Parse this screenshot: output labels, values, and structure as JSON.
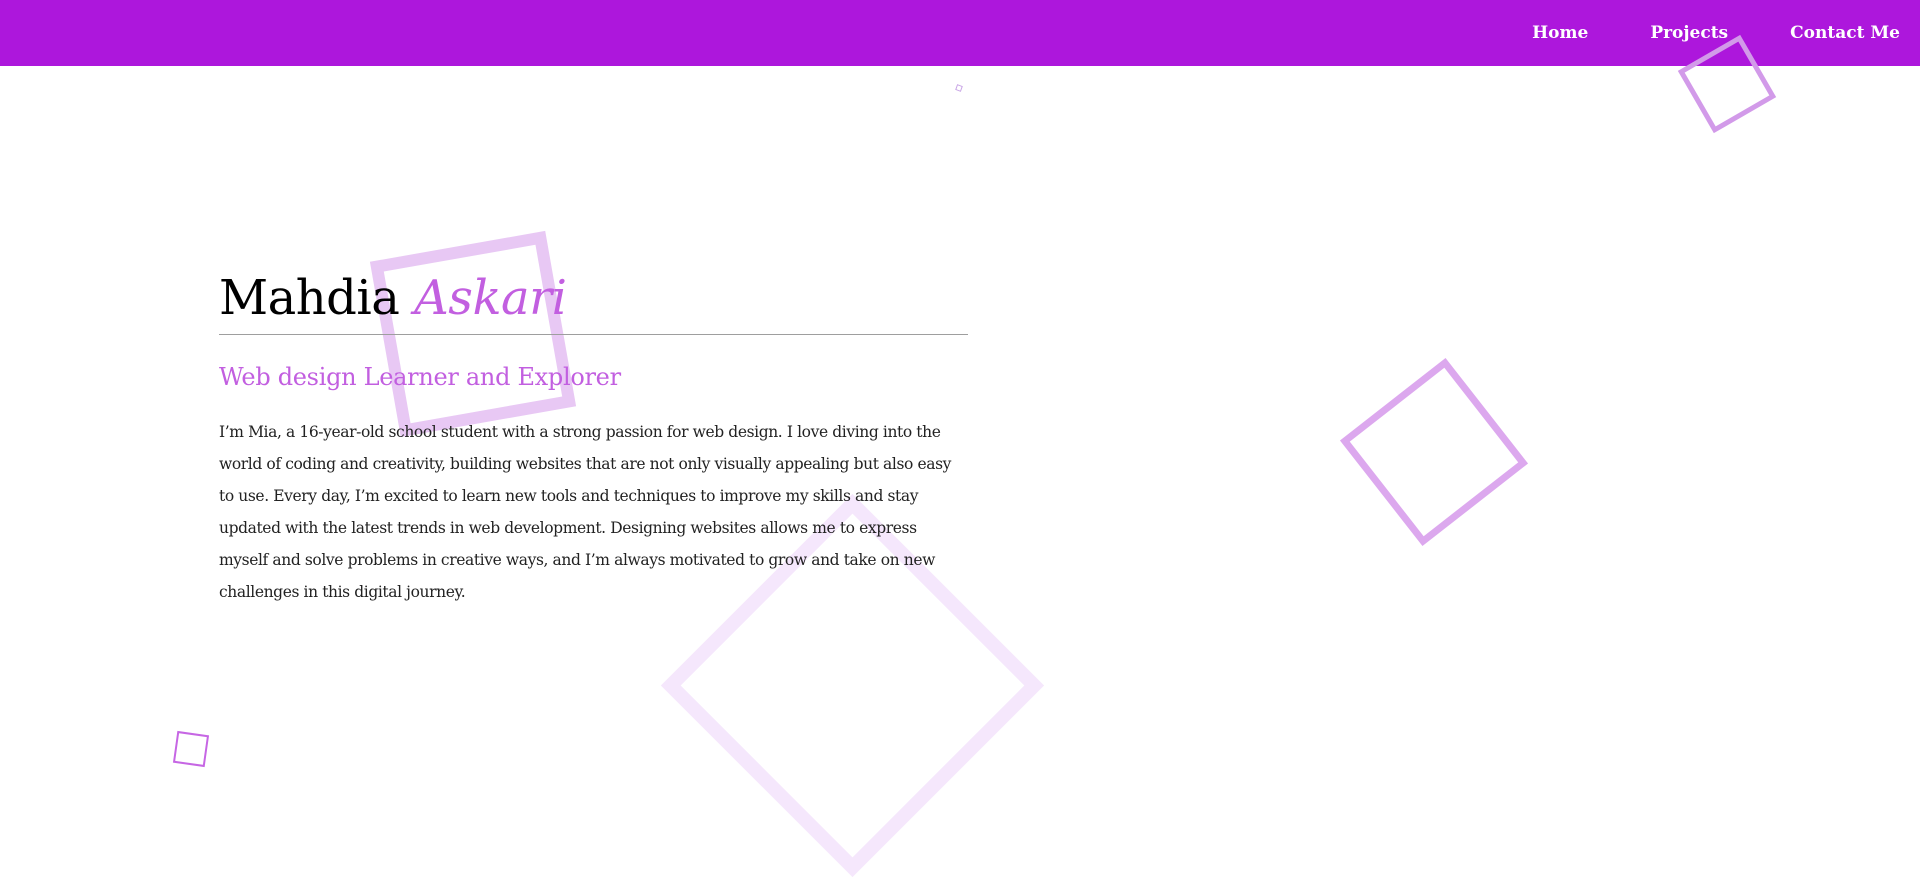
{
  "nav": {
    "items": [
      {
        "label": "Home"
      },
      {
        "label": "Projects"
      },
      {
        "label": "Contact Me"
      }
    ]
  },
  "hero": {
    "first_name": "Mahdia",
    "last_name": "Askari",
    "subtitle": "Web design Learner and Explorer",
    "bio": "I’m Mia, a 16-year-old school student with a strong passion for web design. I love diving into the world of coding and creativity, building websites that are not only visually appealing but also easy to use. Every day, I’m excited to learn new tools and techniques to improve my skills and stay updated with the latest trends in web development. Designing websites allows me to express myself and solve problems in creative ways, and I’m always motivated to grow and take on new challenges in this digital journey."
  },
  "colors": {
    "nav_background": "#ad17dc",
    "accent": "#c25fe0",
    "text": "#222222"
  }
}
